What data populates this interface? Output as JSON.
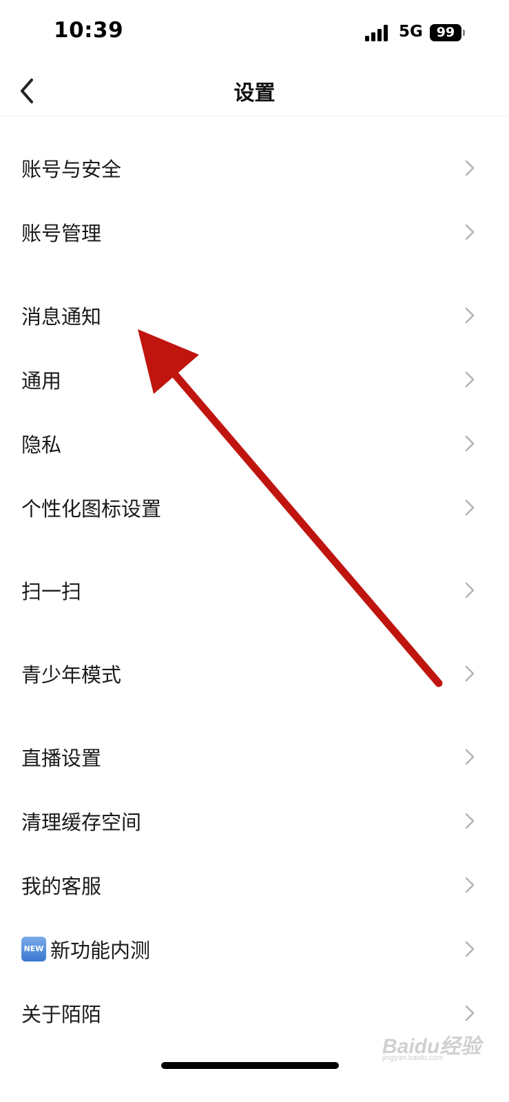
{
  "status_bar": {
    "time": "10:39",
    "network": "5G",
    "battery": "99"
  },
  "header": {
    "title": "设置",
    "back_icon": "chevron-left-icon"
  },
  "settings": {
    "items": [
      {
        "label": "账号与安全"
      },
      {
        "label": "账号管理"
      },
      {
        "label": "消息通知"
      },
      {
        "label": "通用"
      },
      {
        "label": "隐私"
      },
      {
        "label": "个性化图标设置"
      },
      {
        "label": "扫一扫"
      },
      {
        "label": "青少年模式"
      },
      {
        "label": "直播设置"
      },
      {
        "label": "清理缓存空间"
      },
      {
        "label": "我的客服"
      },
      {
        "label": "新功能内测",
        "badge": "NEW"
      },
      {
        "label": "关于陌陌"
      }
    ],
    "chevron_icon": "chevron-right-icon"
  },
  "annotation": {
    "type": "arrow",
    "color": "#c0150f"
  },
  "watermark": {
    "text": "Baidu经验",
    "sub": "jingyan.baidu.com"
  },
  "colors": {
    "background": "#ffffff",
    "text": "#1a1a1a",
    "chevron": "#b3b3b3",
    "divider": "#eeeeee"
  }
}
